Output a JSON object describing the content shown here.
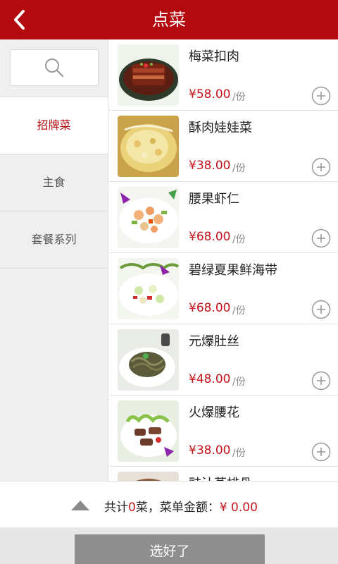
{
  "header": {
    "title": "点菜"
  },
  "categories": [
    {
      "label": "招牌菜",
      "active": true
    },
    {
      "label": "主食",
      "active": false
    },
    {
      "label": "套餐系列",
      "active": false
    }
  ],
  "dishes": [
    {
      "name": "梅菜扣肉",
      "price": "¥58.00",
      "unit": "/份",
      "image": "braised-pork-photo"
    },
    {
      "name": "酥肉娃娃菜",
      "price": "¥38.00",
      "unit": "/份",
      "image": "cabbage-soup-photo"
    },
    {
      "name": "腰果虾仁",
      "price": "¥68.00",
      "unit": "/份",
      "image": "cashew-shrimp-photo"
    },
    {
      "name": "碧绿夏果鲜海带",
      "price": "¥68.00",
      "unit": "/份",
      "image": "seaweed-salad-photo"
    },
    {
      "name": "元爆肚丝",
      "price": "¥48.00",
      "unit": "/份",
      "image": "tripe-shreds-photo"
    },
    {
      "name": "火爆腰花",
      "price": "¥38.00",
      "unit": "/份",
      "image": "kidney-stirfry-photo"
    },
    {
      "name": "豉汁蒸排骨",
      "price": "",
      "unit": "",
      "image": "steamed-ribs-photo"
    }
  ],
  "footer": {
    "summary_prefix": "共计",
    "count": "0",
    "summary_mid": "菜，菜单金额：",
    "amount": "¥ 0.00"
  },
  "submit_label": "选好了",
  "colors": {
    "brand_red": "#b40a0f",
    "price_red": "#c4151b"
  }
}
